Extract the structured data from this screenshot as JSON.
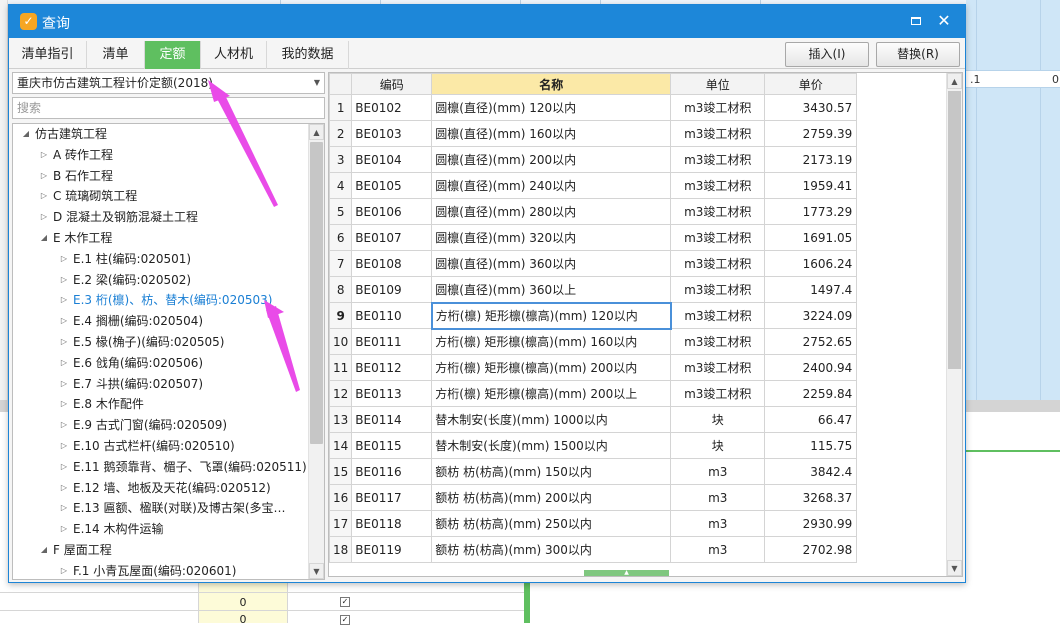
{
  "window": {
    "title": "查询"
  },
  "tabs": [
    {
      "label": "清单指引",
      "active": false
    },
    {
      "label": "清单",
      "active": false
    },
    {
      "label": "定额",
      "active": true
    },
    {
      "label": "人材机",
      "active": false
    },
    {
      "label": "我的数据",
      "active": false
    }
  ],
  "actions": {
    "insert_label": "插入(I)",
    "replace_label": "替换(R)"
  },
  "left": {
    "quota_library": "重庆市仿古建筑工程计价定额(2018)",
    "search_placeholder": "搜索",
    "tree": [
      {
        "label": "仿古建筑工程",
        "level": 0,
        "state": "expanded"
      },
      {
        "label": "A 砖作工程",
        "level": 1,
        "state": "collapsed"
      },
      {
        "label": "B 石作工程",
        "level": 1,
        "state": "collapsed"
      },
      {
        "label": "C 琉璃砌筑工程",
        "level": 1,
        "state": "collapsed"
      },
      {
        "label": "D 混凝土及钢筋混凝土工程",
        "level": 1,
        "state": "collapsed"
      },
      {
        "label": "E 木作工程",
        "level": 1,
        "state": "expanded"
      },
      {
        "label": "E.1 柱(编码:020501)",
        "level": 2,
        "state": "collapsed"
      },
      {
        "label": "E.2 梁(编码:020502)",
        "level": 2,
        "state": "collapsed"
      },
      {
        "label": "E.3 桁(檩)、枋、替木(编码:020503)",
        "level": 2,
        "state": "collapsed",
        "selected": true
      },
      {
        "label": "E.4 搁栅(编码:020504)",
        "level": 2,
        "state": "collapsed"
      },
      {
        "label": "E.5 椽(桷子)(编码:020505)",
        "level": 2,
        "state": "collapsed"
      },
      {
        "label": "E.6 戗角(编码:020506)",
        "level": 2,
        "state": "collapsed"
      },
      {
        "label": "E.7 斗拱(编码:020507)",
        "level": 2,
        "state": "collapsed"
      },
      {
        "label": "E.8 木作配件",
        "level": 2,
        "state": "collapsed"
      },
      {
        "label": "E.9 古式门窗(编码:020509)",
        "level": 2,
        "state": "collapsed"
      },
      {
        "label": "E.10 古式栏杆(编码:020510)",
        "level": 2,
        "state": "collapsed"
      },
      {
        "label": "E.11 鹅颈靠背、楣子、飞罩(编码:020511)",
        "level": 2,
        "state": "collapsed"
      },
      {
        "label": "E.12 墙、地板及天花(编码:020512)",
        "level": 2,
        "state": "collapsed"
      },
      {
        "label": "E.13 匾额、楹联(对联)及博古架(多宝…",
        "level": 2,
        "state": "collapsed"
      },
      {
        "label": "E.14 木构件运输",
        "level": 2,
        "state": "collapsed"
      },
      {
        "label": "F 屋面工程",
        "level": 1,
        "state": "expanded"
      },
      {
        "label": "F.1 小青瓦屋面(编码:020601)",
        "level": 2,
        "state": "collapsed"
      }
    ]
  },
  "grid": {
    "columns": [
      "编码",
      "名称",
      "单位",
      "单价"
    ],
    "current_row": 9,
    "rows": [
      {
        "no": "1",
        "code": "BE0102",
        "name": "圆檩(直径)(mm) 120以内",
        "unit": "m3竣工材积",
        "price": "3430.57"
      },
      {
        "no": "2",
        "code": "BE0103",
        "name": "圆檩(直径)(mm) 160以内",
        "unit": "m3竣工材积",
        "price": "2759.39"
      },
      {
        "no": "3",
        "code": "BE0104",
        "name": "圆檩(直径)(mm) 200以内",
        "unit": "m3竣工材积",
        "price": "2173.19"
      },
      {
        "no": "4",
        "code": "BE0105",
        "name": "圆檩(直径)(mm) 240以内",
        "unit": "m3竣工材积",
        "price": "1959.41"
      },
      {
        "no": "5",
        "code": "BE0106",
        "name": "圆檩(直径)(mm) 280以内",
        "unit": "m3竣工材积",
        "price": "1773.29"
      },
      {
        "no": "6",
        "code": "BE0107",
        "name": "圆檩(直径)(mm) 320以内",
        "unit": "m3竣工材积",
        "price": "1691.05"
      },
      {
        "no": "7",
        "code": "BE0108",
        "name": "圆檩(直径)(mm) 360以内",
        "unit": "m3竣工材积",
        "price": "1606.24"
      },
      {
        "no": "8",
        "code": "BE0109",
        "name": "圆檩(直径)(mm) 360以上",
        "unit": "m3竣工材积",
        "price": "1497.4"
      },
      {
        "no": "9",
        "code": "BE0110",
        "name": "方桁(檩) 矩形檩(檩高)(mm) 120以内",
        "unit": "m3竣工材积",
        "price": "3224.09"
      },
      {
        "no": "10",
        "code": "BE0111",
        "name": "方桁(檩) 矩形檩(檩高)(mm) 160以内",
        "unit": "m3竣工材积",
        "price": "2752.65"
      },
      {
        "no": "11",
        "code": "BE0112",
        "name": "方桁(檩) 矩形檩(檩高)(mm) 200以内",
        "unit": "m3竣工材积",
        "price": "2400.94"
      },
      {
        "no": "12",
        "code": "BE0113",
        "name": "方桁(檩) 矩形檩(檩高)(mm) 200以上",
        "unit": "m3竣工材积",
        "price": "2259.84"
      },
      {
        "no": "13",
        "code": "BE0114",
        "name": "替木制安(长度)(mm) 1000以内",
        "unit": "块",
        "price": "66.47"
      },
      {
        "no": "14",
        "code": "BE0115",
        "name": "替木制安(长度)(mm) 1500以内",
        "unit": "块",
        "price": "115.75"
      },
      {
        "no": "15",
        "code": "BE0116",
        "name": "额枋 枋(枋高)(mm) 150以内",
        "unit": "m3",
        "price": "3842.4"
      },
      {
        "no": "16",
        "code": "BE0117",
        "name": "额枋 枋(枋高)(mm) 200以内",
        "unit": "m3",
        "price": "3268.37"
      },
      {
        "no": "17",
        "code": "BE0118",
        "name": "额枋 枋(枋高)(mm) 250以内",
        "unit": "m3",
        "price": "2930.99"
      },
      {
        "no": "18",
        "code": "BE0119",
        "name": "额枋 枋(枋高)(mm) 300以内",
        "unit": "m3",
        "price": "2702.98"
      }
    ]
  },
  "background": {
    "strip_values": [
      ".1",
      "0"
    ],
    "bottom_values": [
      "0",
      "0",
      "0"
    ]
  },
  "colors": {
    "titlebar": "#1d87d9",
    "active_tab": "#5fbf60",
    "selected_tree_text": "#1a7fd4",
    "name_header": "#fbe9a7",
    "annotation_arrow": "#e94be8"
  },
  "icons": {
    "app": "query-app-icon",
    "minimize": "minimize-icon",
    "close": "close-icon",
    "dropdown": "dropdown-arrow-icon",
    "tree_expanded": "triangle-down-icon",
    "tree_collapsed": "triangle-right-icon"
  }
}
